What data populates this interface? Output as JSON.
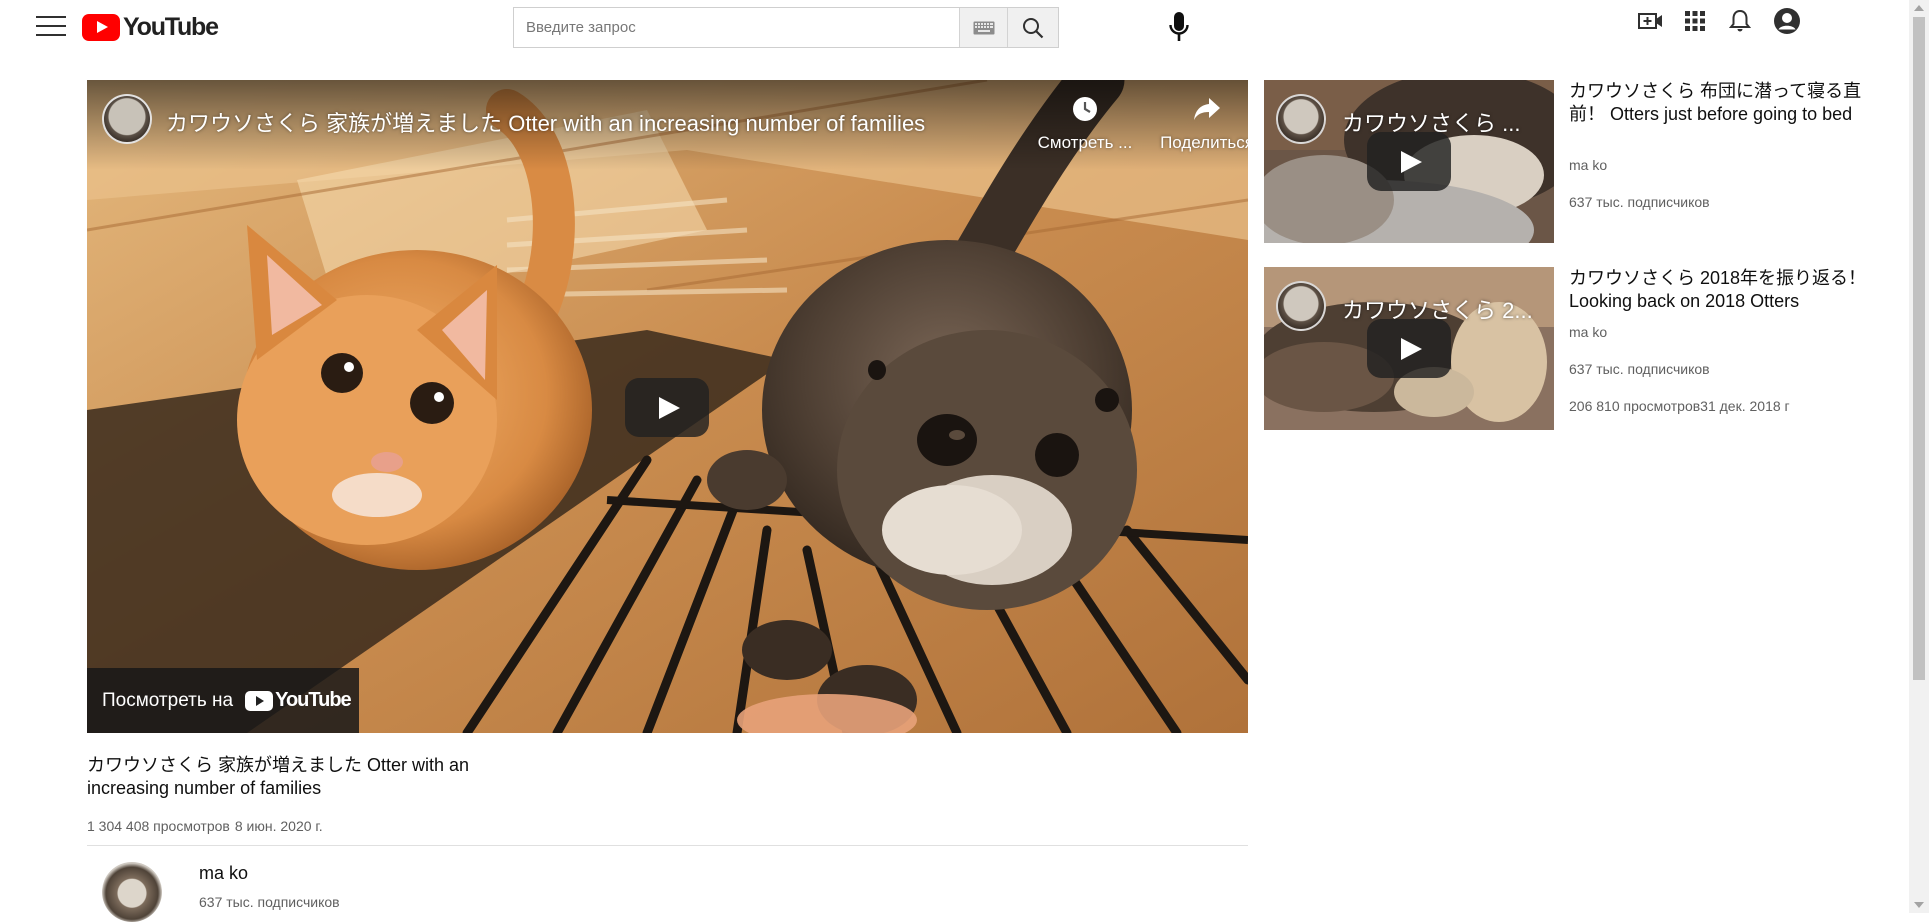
{
  "header": {
    "logo_text": "YouTube",
    "search_placeholder": "Введите запрос",
    "search_value": "",
    "icons": [
      "menu-icon",
      "keyboard-icon",
      "search-icon",
      "mic-icon",
      "create-video-icon",
      "apps-grid-icon",
      "bell-icon",
      "account-icon"
    ]
  },
  "player": {
    "title": "カワウソさくら 家族が増えました Otter with an increasing number of families",
    "watch_later_label": "Смотреть ...",
    "share_label": "Поделиться",
    "watch_on_label": "Посмотреть на",
    "watch_on_logo": "YouTube"
  },
  "video": {
    "title": "カワウソさくら 家族が増えました Otter with an increasing number of families",
    "views": "1 304 408 просмотров",
    "date": "8 июн. 2020 г."
  },
  "owner": {
    "name": "ma ko",
    "subscribers": "637 тыс. подписчиков"
  },
  "related": [
    {
      "thumb_title": "カワウソさくら ...",
      "title": "カワウソさくら 布団に潜って寝る直前！ Otters just before going to bed",
      "channel": "ma ko",
      "subscribers": "637 тыс. подписчиков",
      "views_date": ""
    },
    {
      "thumb_title": "カワウソさくら 2...",
      "title": "カワウソさくら 2018年を振り返る！ Looking back on 2018 Otters",
      "channel": "ma ko",
      "subscribers": "637 тыс. подписчиков",
      "views_date": "206 810 просмотров31 дек. 2018 г"
    }
  ],
  "colors": {
    "brand_red": "#ff0000",
    "text_primary": "#0f0f0f",
    "text_secondary": "#606060"
  }
}
